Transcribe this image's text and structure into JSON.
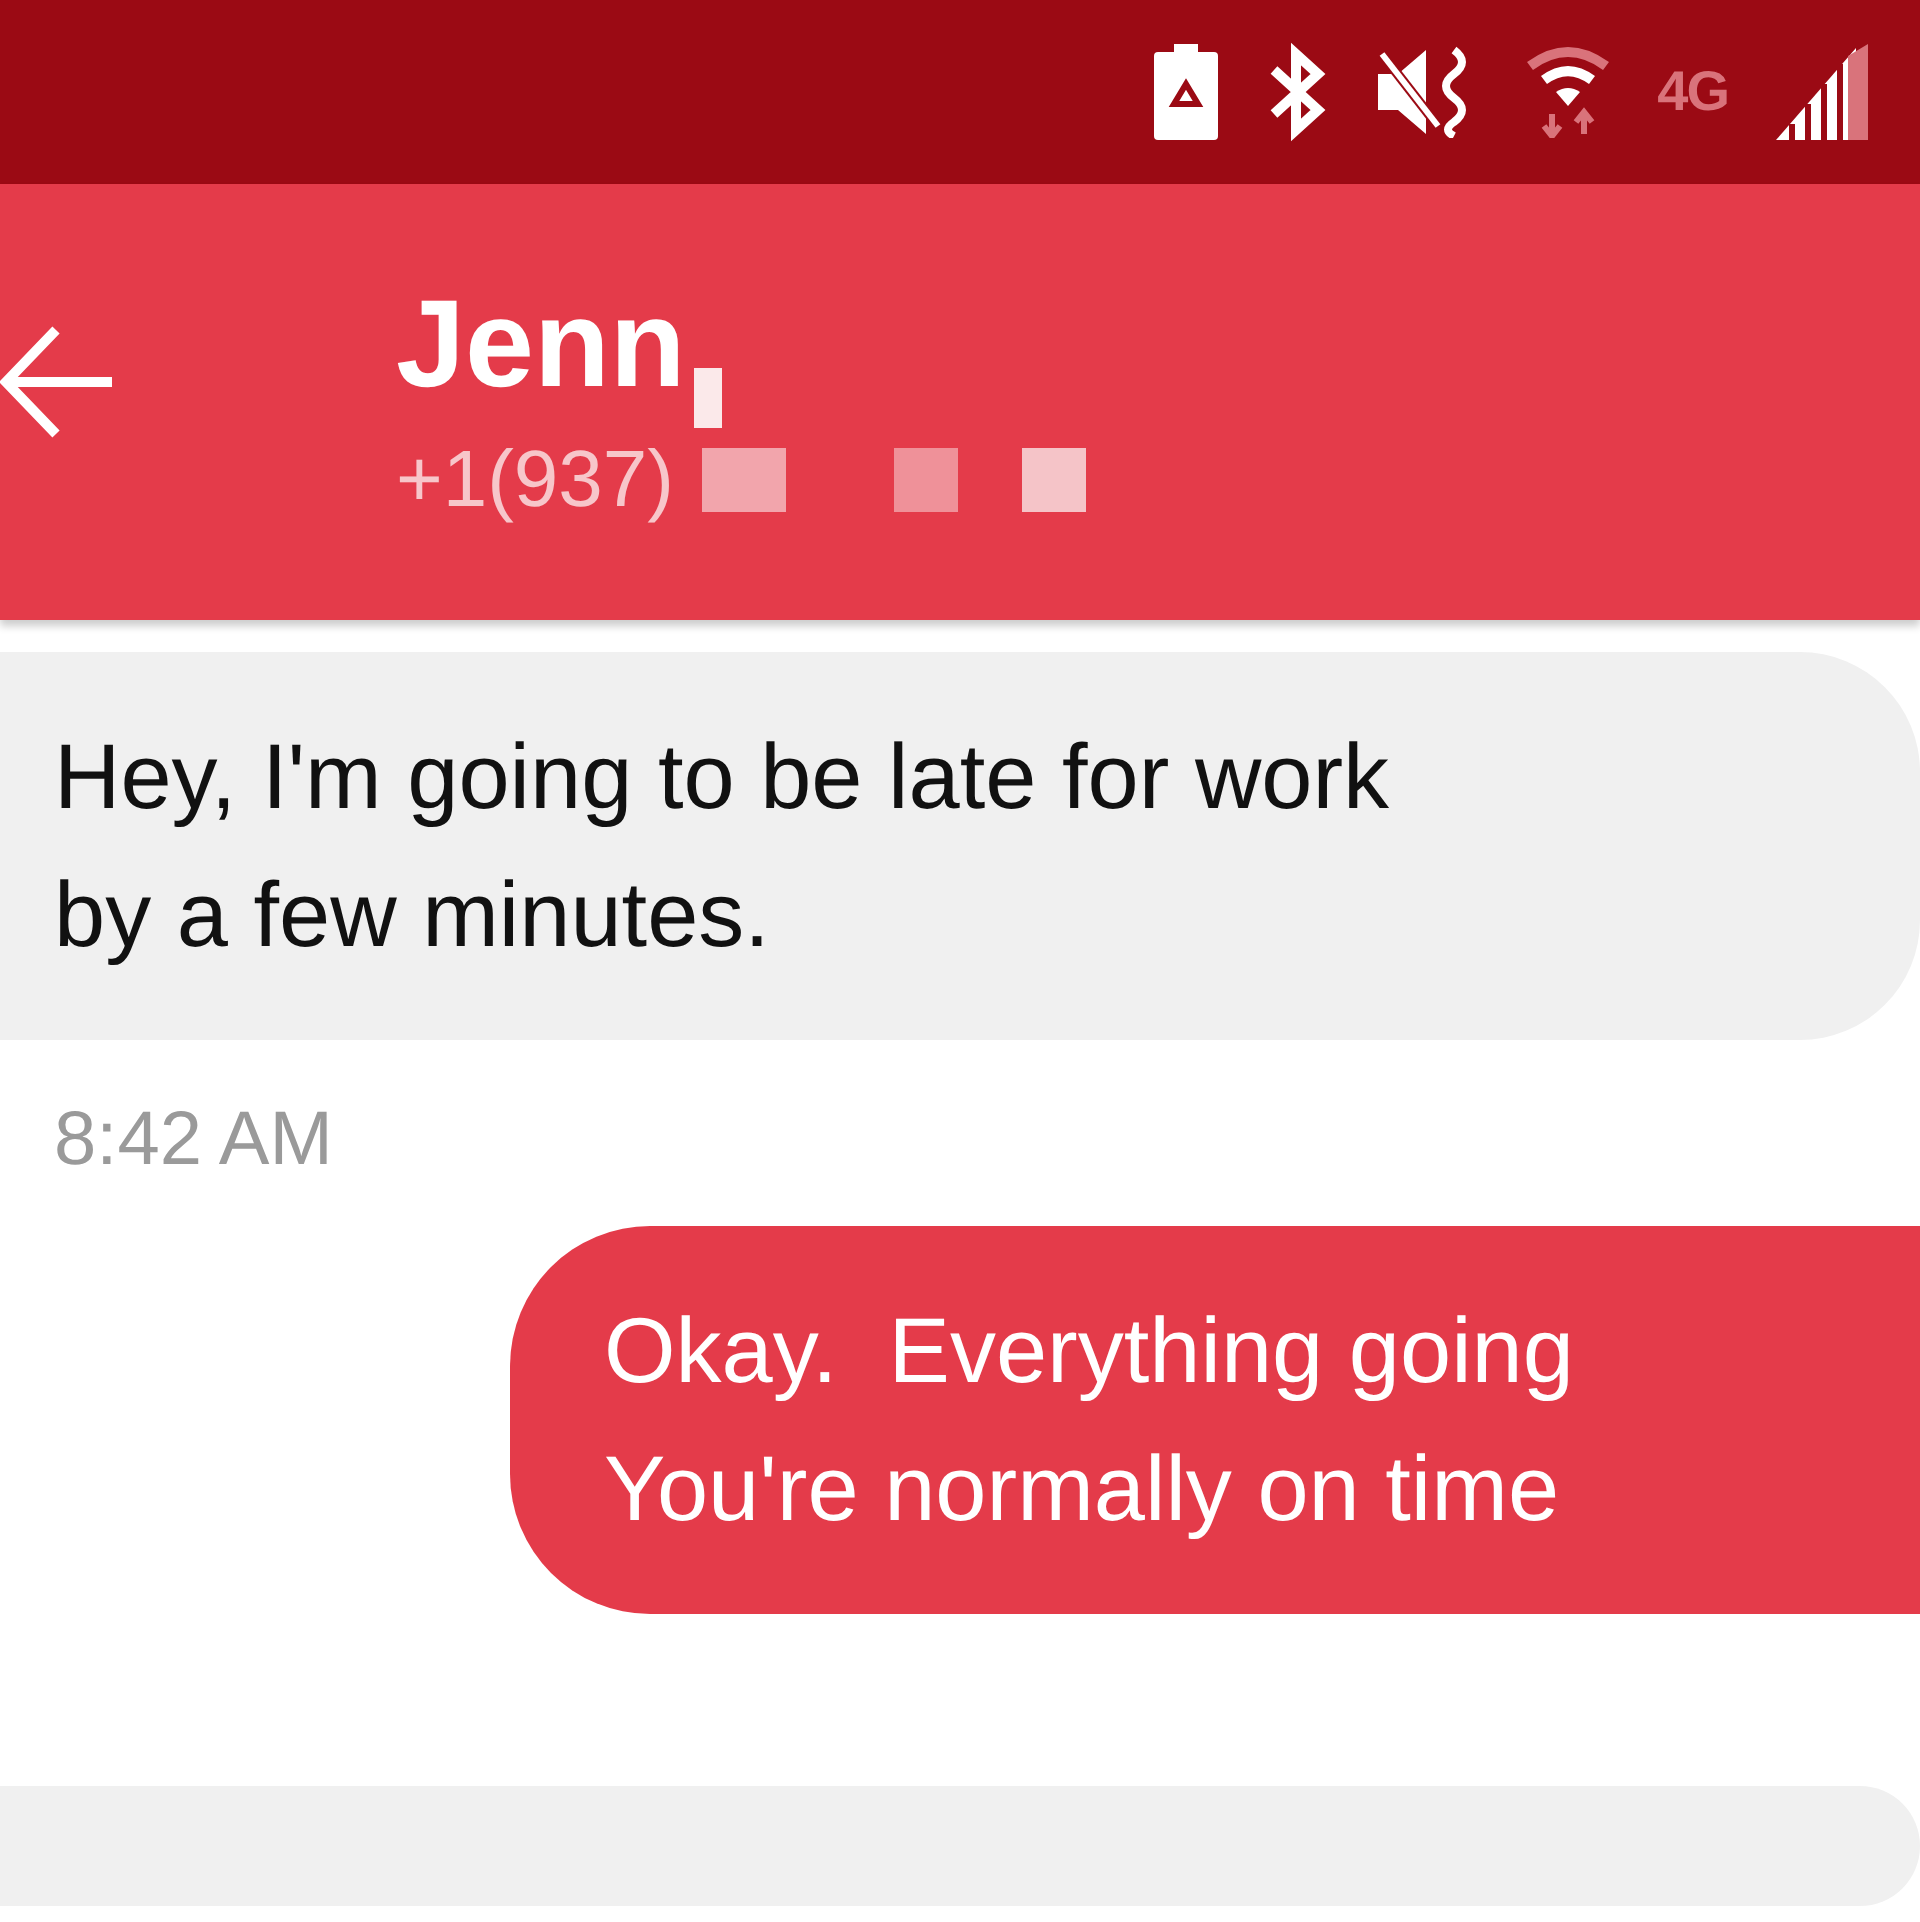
{
  "status_bar": {
    "network_label": "4G"
  },
  "header": {
    "contact_name": "Jenn",
    "phone": "+1(937)"
  },
  "messages": [
    {
      "kind": "incoming",
      "text": "Hey, I'm going to be late for work\nby a few minutes."
    },
    {
      "kind": "time",
      "text": "8:42 AM"
    },
    {
      "kind": "outgoing",
      "text": "Okay.  Everything going\nYou're normally on time"
    },
    {
      "kind": "incoming"
    }
  ]
}
